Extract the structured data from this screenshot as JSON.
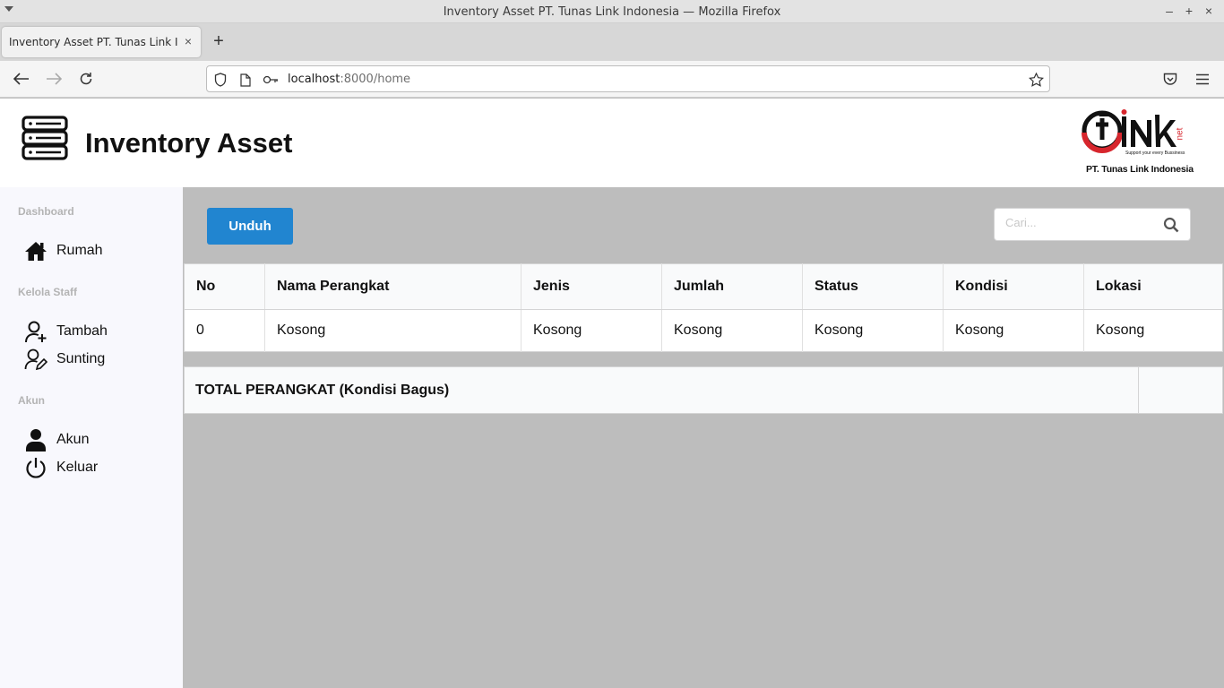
{
  "window": {
    "title": "Inventory Asset PT. Tunas Link Indonesia — Mozilla Firefox"
  },
  "browser": {
    "tab_title": "Inventory Asset PT. Tunas Link Indonesia",
    "url_host": "localhost",
    "url_rest": ":8000/home"
  },
  "header": {
    "title": "Inventory Asset",
    "brand_company": "PT. Tunas Link Indonesia",
    "brand_tagline": "Support your every Bussiness",
    "brand_net": "net"
  },
  "sidebar": {
    "sections": [
      {
        "title": "Dashboard",
        "items": [
          {
            "label": "Rumah",
            "icon": "home-icon"
          }
        ]
      },
      {
        "title": "Kelola Staff",
        "items": [
          {
            "label": "Tambah",
            "icon": "user-plus-icon"
          },
          {
            "label": "Sunting",
            "icon": "user-edit-icon"
          }
        ]
      },
      {
        "title": "Akun",
        "items": [
          {
            "label": "Akun",
            "icon": "user-icon"
          },
          {
            "label": "Keluar",
            "icon": "power-icon"
          }
        ]
      }
    ]
  },
  "toolbar": {
    "download_label": "Unduh",
    "search_placeholder": "Cari...",
    "search_value": ""
  },
  "table": {
    "columns": [
      "No",
      "Nama Perangkat",
      "Jenis",
      "Jumlah",
      "Status",
      "Kondisi",
      "Lokasi"
    ],
    "rows": [
      [
        "0",
        "Kosong",
        "Kosong",
        "Kosong",
        "Kosong",
        "Kosong",
        "Kosong"
      ]
    ]
  },
  "total": {
    "label": "TOTAL PERANGKAT (Kondisi Bagus)",
    "value": ""
  },
  "colors": {
    "primary_button": "#2185d0",
    "content_bg": "#bdbdbd",
    "sidebar_bg": "#f8f8fd",
    "brand_red": "#d7262d"
  }
}
